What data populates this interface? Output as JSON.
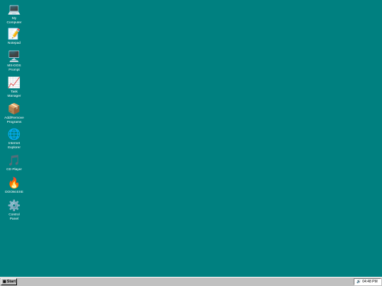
{
  "desktop": {
    "background_color": "#008080",
    "icons": [
      {
        "name": "my-computer",
        "glyph": "💻",
        "label": "My\nComputer"
      },
      {
        "name": "notepad",
        "glyph": "📝",
        "label": "Notepad"
      },
      {
        "name": "ms-dos-prompt",
        "glyph": "🖥️",
        "label": "MS-DOS\nPrompt"
      },
      {
        "name": "task-manager",
        "glyph": "📈",
        "label": "Task\nManager"
      },
      {
        "name": "add-remove-programs",
        "glyph": "📦",
        "label": "Add/Remove\nPrograms"
      },
      {
        "name": "internet-explorer",
        "glyph": "🌐",
        "label": "Internet\nExplorer"
      },
      {
        "name": "cd-player",
        "glyph": "🎵",
        "label": "CD Player"
      },
      {
        "name": "doom-exe",
        "glyph": "🔥",
        "label": "DOOM.EXE"
      },
      {
        "name": "control-panel",
        "glyph": "⚙️",
        "label": "Control\nPanel"
      }
    ]
  },
  "taskbar": {
    "start_label": "Start",
    "start_glyph": "▦",
    "tray": {
      "volume_glyph": "🔊",
      "clock": "04:48 PM"
    }
  }
}
